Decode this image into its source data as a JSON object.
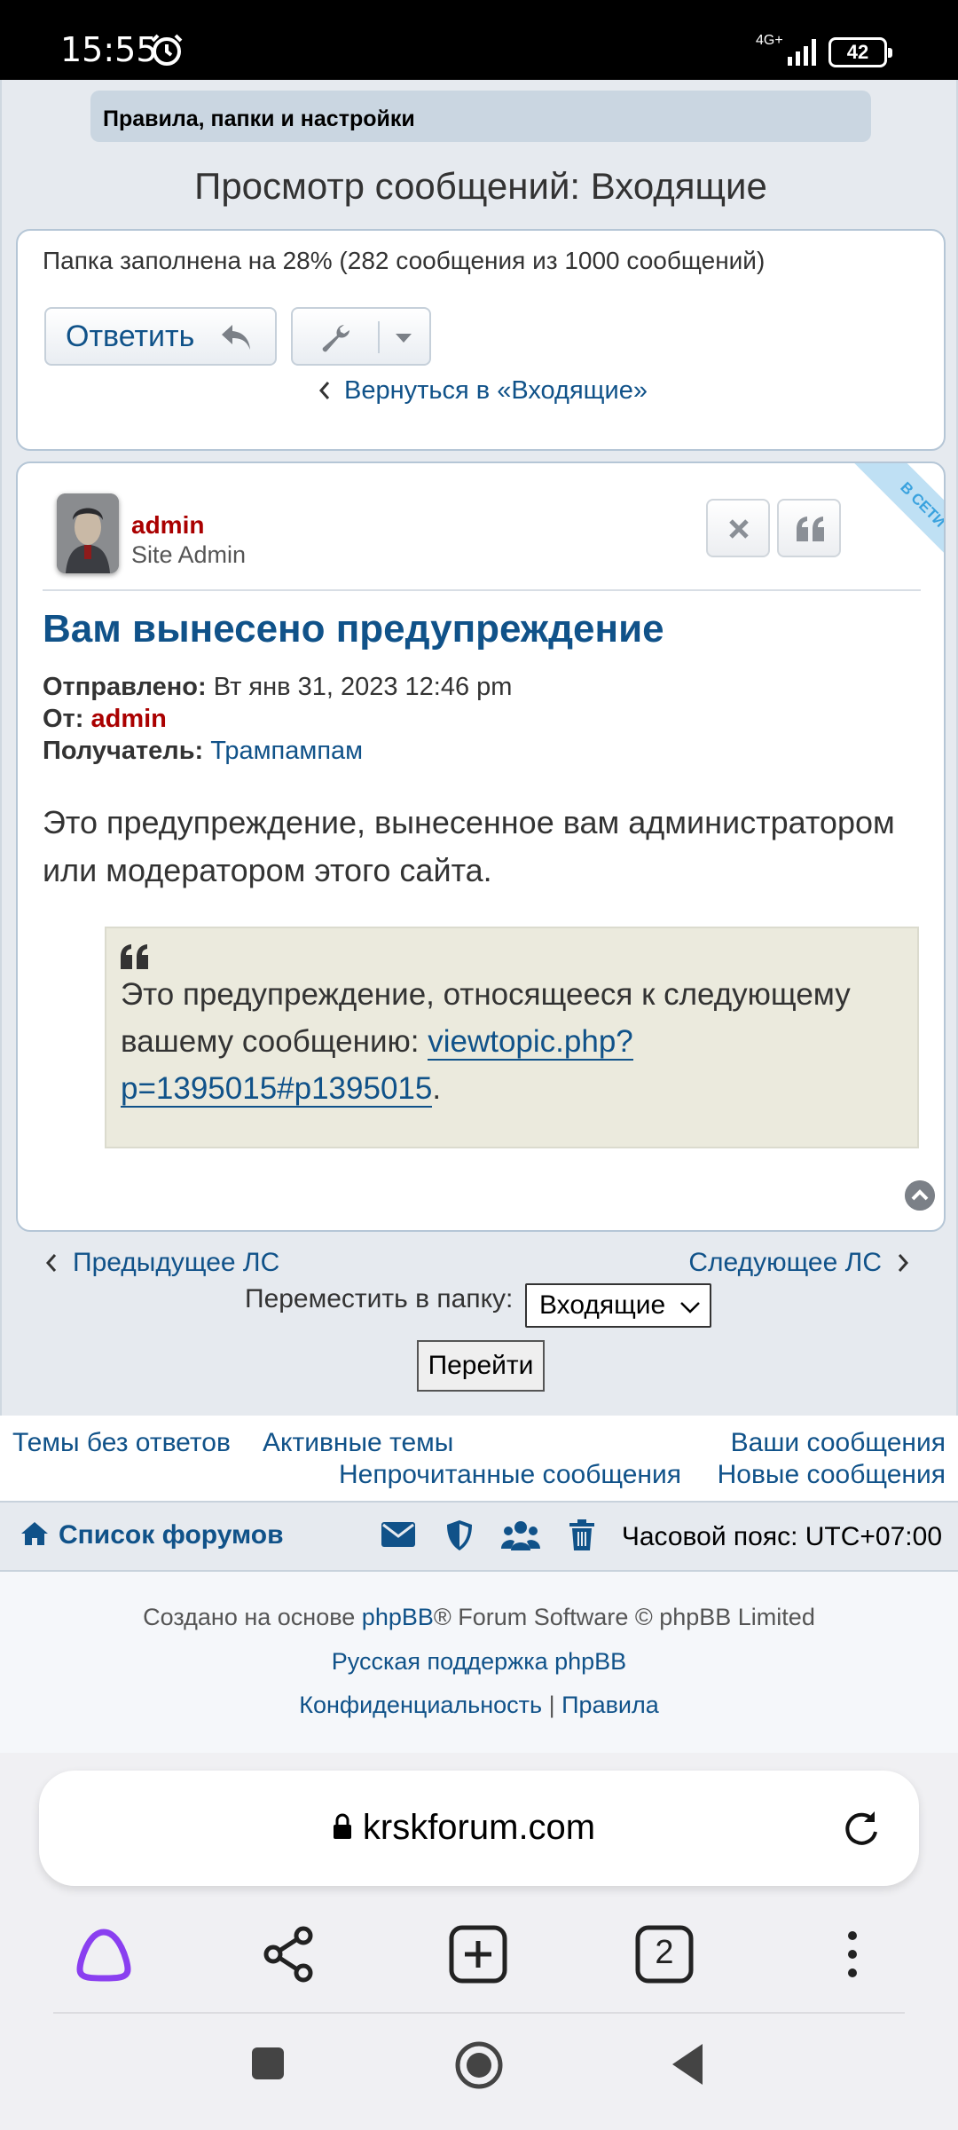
{
  "status_bar": {
    "time": "15:55",
    "network": "4G+",
    "battery": "42"
  },
  "breadcrumb": "Правила, папки и настройки",
  "page_title": "Просмотр сообщений: Входящие",
  "folder_usage": "Папка заполнена на 28% (282 сообщения из 1000 сообщений)",
  "toolbar": {
    "reply_label": "Ответить",
    "back_link": "Вернуться в «Входящие»"
  },
  "message": {
    "author": "admin",
    "author_rank": "Site Admin",
    "online_badge": "В СЕТИ",
    "title": "Вам вынесено предупреждение",
    "sent_label": "Отправлено:",
    "sent_value": "Вт янв 31, 2023 12:46 pm",
    "from_label": "От:",
    "from_value": "admin",
    "to_label": "Получатель:",
    "to_value": "Трампампам",
    "body": "Это предупреждение, вынесенное вам администратором или модератором этого сайта.",
    "quote_text": "Это предупреждение, относящееся к следующему вашему сообщению:",
    "quote_link": "viewtopic.php?p=1395015#p1395015",
    "quote_dot": "."
  },
  "pm_nav": {
    "prev": "Предыдущее ЛС",
    "next": "Следующее ЛС",
    "move_label": "Переместить в папку:",
    "folder_selected": "Входящие",
    "go_button": "Перейти"
  },
  "quick_links": {
    "unanswered": "Темы без ответов",
    "active": "Активные темы",
    "your_posts": "Ваши сообщения",
    "unread": "Непрочитанные сообщения",
    "new_posts": "Новые сообщения"
  },
  "navbar": {
    "forum_index": "Список форумов",
    "timezone": "Часовой пояс: UTC+07:00"
  },
  "footer": {
    "line1_prefix": "Создано на основе ",
    "line1_link": "phpBB",
    "line1_suffix": "® Forum Software © phpBB Limited",
    "line2": "Русская поддержка phpBB",
    "privacy": "Конфиденциальность",
    "separator": " | ",
    "rules": "Правила"
  },
  "browser": {
    "url": "krskforum.com",
    "tab_count": "2"
  },
  "colors": {
    "link": "#105289",
    "admin": "#aa0000",
    "quote_bg": "#ebeadd",
    "online_ribbon": "#bfe0f4"
  },
  "icons": [
    "alarm-icon",
    "signal-icon",
    "reply-arrow-icon",
    "wrench-icon",
    "caret-down-icon",
    "chevron-left-icon",
    "chevron-right-icon",
    "close-icon",
    "quote-icon",
    "scroll-top-icon",
    "home-icon",
    "envelope-icon",
    "shield-icon",
    "users-icon",
    "trash-icon",
    "lock-icon",
    "reload-icon",
    "alice-icon",
    "share-icon",
    "new-tab-icon",
    "more-icon"
  ]
}
